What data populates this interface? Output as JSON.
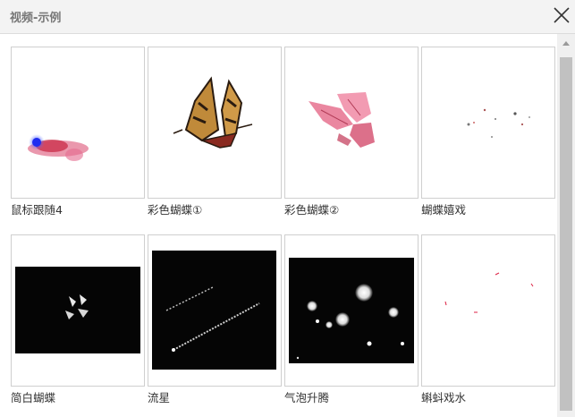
{
  "window": {
    "title": "视频-示例"
  },
  "items": [
    {
      "label": "鼠标跟随4"
    },
    {
      "label": "彩色蝴蝶①"
    },
    {
      "label": "彩色蝴蝶②"
    },
    {
      "label": "蝴蝶嬉戏"
    },
    {
      "label": "简白蝴蝶"
    },
    {
      "label": "流星"
    },
    {
      "label": "气泡升腾"
    },
    {
      "label": "蝌蚪戏水"
    }
  ],
  "icons": {
    "close": "close-icon",
    "scroll_up": "chevron-up-icon"
  }
}
